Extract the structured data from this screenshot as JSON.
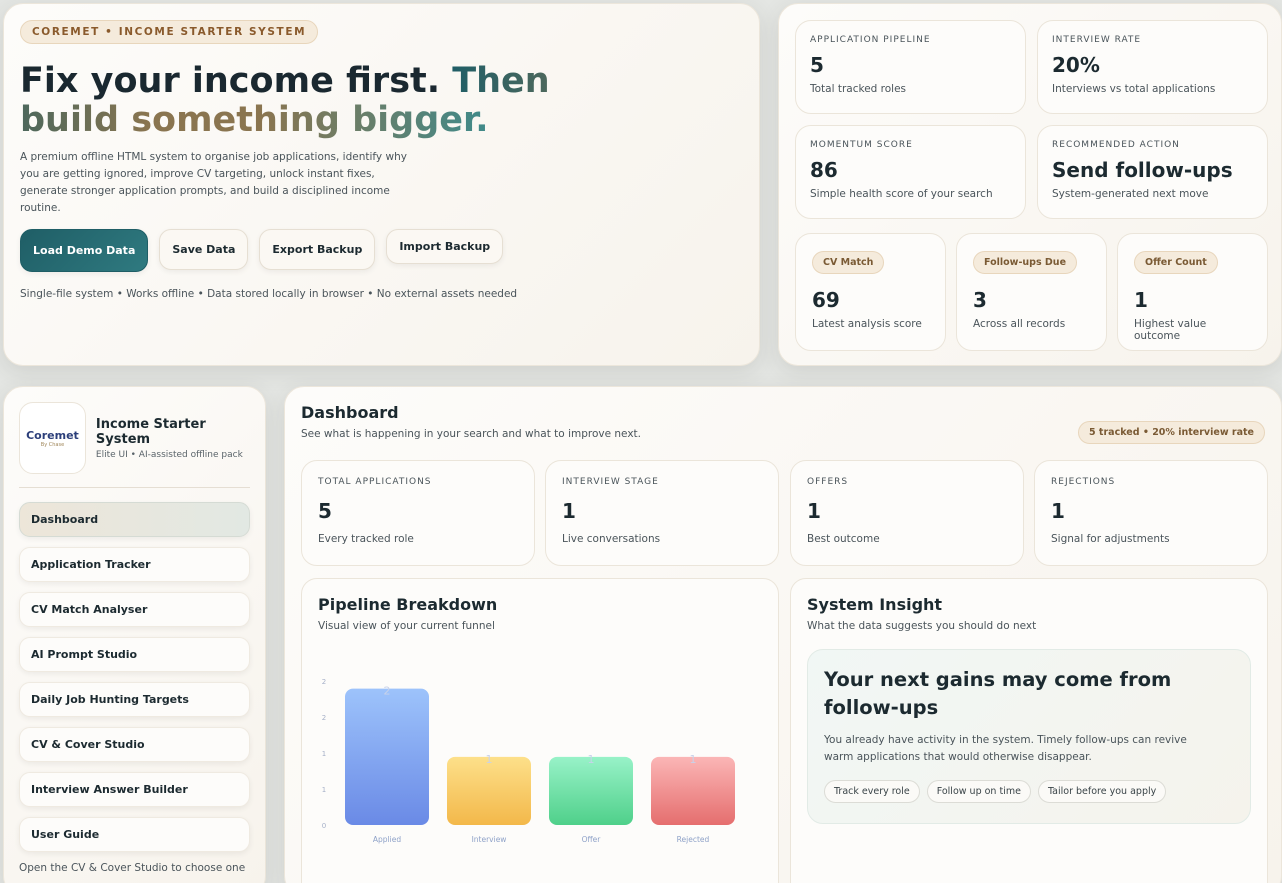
{
  "hero": {
    "tag": "COREMET • INCOME STARTER SYSTEM",
    "title_plain": "Fix your income first.",
    "title_grad": "Then build something bigger.",
    "description": "A premium offline HTML system to organise job applications, identify why you are getting ignored, improve CV targeting, unlock instant fixes, generate stronger application prompts, and build a disciplined income routine.",
    "buttons": {
      "load_demo": "Load Demo Data",
      "save": "Save Data",
      "export": "Export Backup",
      "import": "Import Backup"
    },
    "footer": "Single-file system • Works offline • Data stored locally in browser • No external assets needed"
  },
  "stats_top": {
    "pipeline": {
      "label": "APPLICATION PIPELINE",
      "value": "5",
      "sub": "Total tracked roles"
    },
    "interview_rate": {
      "label": "INTERVIEW RATE",
      "value": "20%",
      "sub": "Interviews vs total applications"
    },
    "momentum": {
      "label": "MOMENTUM SCORE",
      "value": "86",
      "sub": "Simple health score of your search"
    },
    "action": {
      "label": "RECOMMENDED ACTION",
      "value": "Send follow-ups",
      "sub": "System-generated next move"
    },
    "cv_match": {
      "chip": "CV Match",
      "value": "69",
      "sub": "Latest analysis score"
    },
    "followups": {
      "chip": "Follow-ups Due",
      "value": "3",
      "sub": "Across all records"
    },
    "offers": {
      "chip": "Offer Count",
      "value": "1",
      "sub": "Highest value outcome"
    }
  },
  "sidebar": {
    "logo_text": "Coremet",
    "logo_sub": "By Chase",
    "brand_name": "Income Starter System",
    "brand_sub": "Elite UI • AI-assisted offline pack",
    "items": [
      {
        "label": "Dashboard"
      },
      {
        "label": "Application Tracker"
      },
      {
        "label": "CV Match Analyser"
      },
      {
        "label": "AI Prompt Studio"
      },
      {
        "label": "Daily Job Hunting Targets"
      },
      {
        "label": "CV & Cover Studio"
      },
      {
        "label": "Interview Answer Builder"
      },
      {
        "label": "User Guide"
      }
    ],
    "footer": "Open the CV & Cover Studio to choose one"
  },
  "main": {
    "title": "Dashboard",
    "subtitle": "See what is happening in your search and what to improve next.",
    "badge": "5 tracked • 20% interview rate",
    "cards": [
      {
        "label": "TOTAL APPLICATIONS",
        "value": "5",
        "sub": "Every tracked role"
      },
      {
        "label": "INTERVIEW STAGE",
        "value": "1",
        "sub": "Live conversations"
      },
      {
        "label": "OFFERS",
        "value": "1",
        "sub": "Best outcome"
      },
      {
        "label": "REJECTIONS",
        "value": "1",
        "sub": "Signal for adjustments"
      }
    ],
    "pipeline": {
      "title": "Pipeline Breakdown",
      "subtitle": "Visual view of your current funnel"
    },
    "insight": {
      "title": "System Insight",
      "subtitle": "What the data suggests you should do next",
      "headline": "Your next gains may come from follow-ups",
      "body": "You already have activity in the system. Timely follow-ups can revive warm applications that would otherwise disappear.",
      "tags": [
        "Track every role",
        "Follow up on time",
        "Tailor before you apply"
      ]
    }
  },
  "chart_data": {
    "type": "bar",
    "categories": [
      "Applied",
      "Interview",
      "Offer",
      "Rejected"
    ],
    "values": [
      2,
      1,
      1,
      1
    ],
    "y_ticks": [
      "0",
      "1",
      "1",
      "2",
      "2"
    ],
    "ylim": [
      0,
      2.2
    ],
    "colors": [
      [
        "#9dc3fb",
        "#6a8ae6"
      ],
      [
        "#fde08a",
        "#f3b84a"
      ],
      [
        "#98f2c8",
        "#4fd08a"
      ],
      [
        "#fbb6b6",
        "#e56e6e"
      ]
    ],
    "grid": false
  }
}
